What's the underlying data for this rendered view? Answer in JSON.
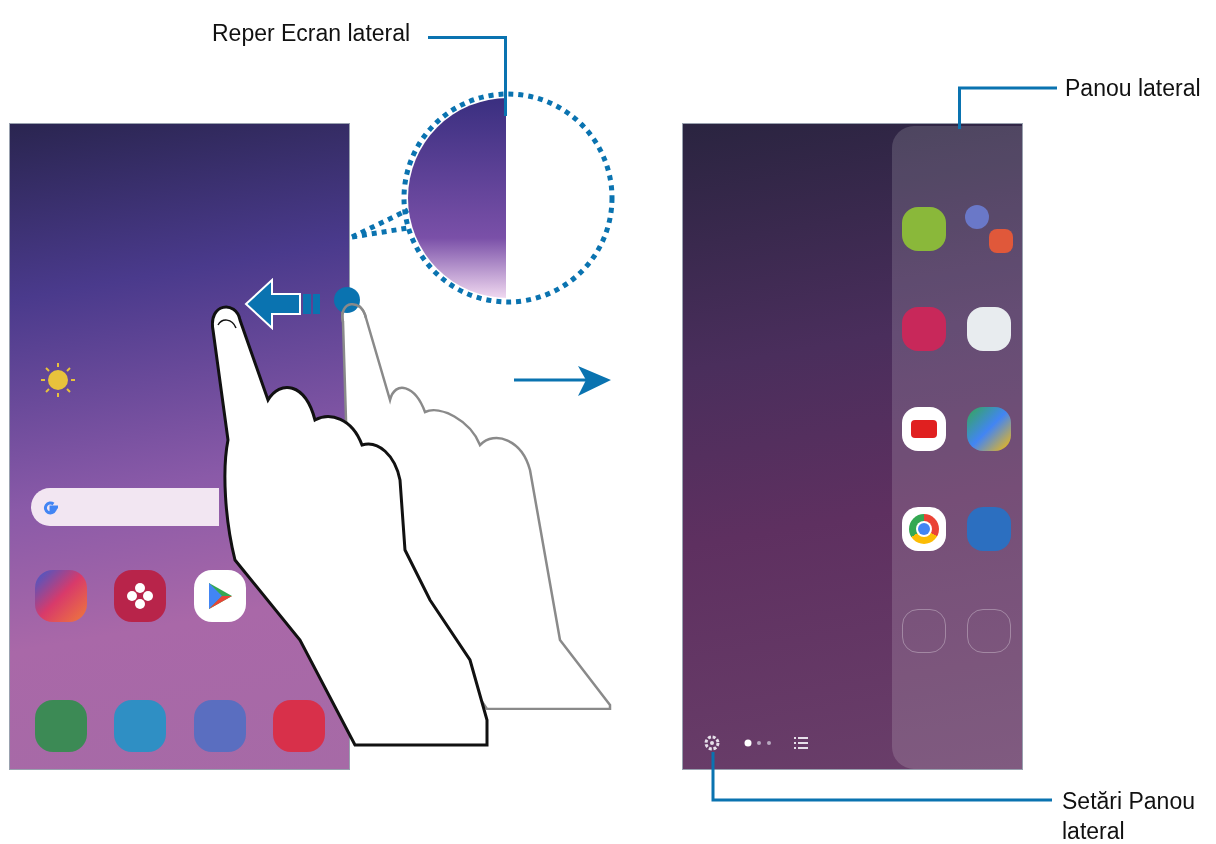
{
  "callouts": [
    {
      "kind": "edge-handle",
      "label": "Reper Ecran lateral"
    },
    {
      "kind": "edge-panel",
      "label": "Panou lateral"
    },
    {
      "kind": "panel-settings",
      "label": "Setări Panou lateral"
    }
  ]
}
